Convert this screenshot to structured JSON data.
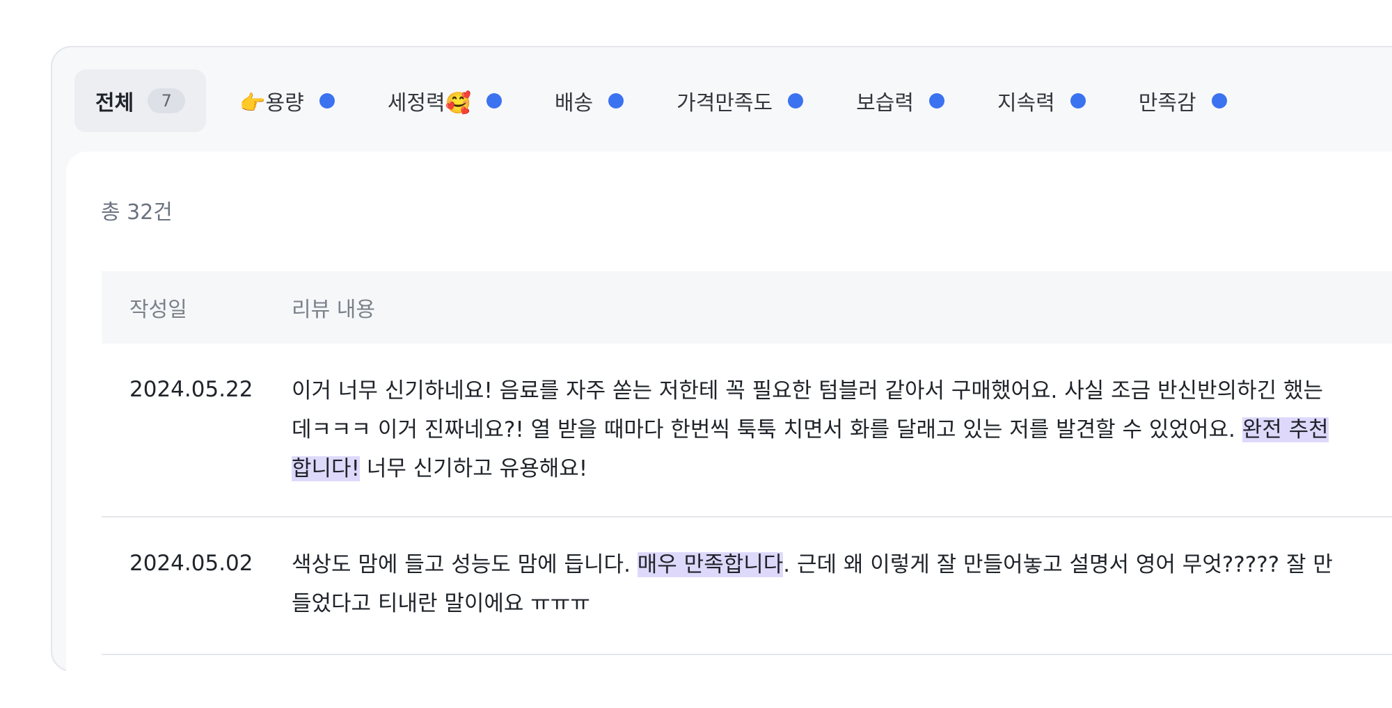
{
  "tabs": [
    {
      "label": "전체",
      "count": "7",
      "active": true
    },
    {
      "label": "👉용량"
    },
    {
      "label": "세정력🥰"
    },
    {
      "label": "배송"
    },
    {
      "label": "가격만족도"
    },
    {
      "label": "보습력"
    },
    {
      "label": "지속력"
    },
    {
      "label": "만족감"
    }
  ],
  "summary": {
    "total": "총 32건"
  },
  "table": {
    "headers": {
      "date": "작성일",
      "content": "리뷰 내용"
    },
    "rows": [
      {
        "date": "2024.05.22",
        "text_before": "이거 너무 신기하네요! 음료를 자주 쏟는 저한테 꼭 필요한 텀블러 같아서 구매했어요. 사실 조금 반신반의하긴 했는데ㅋㅋㅋ 이거 진짜네요?! 열 받을 때마다 한번씩 툭툭 치면서 화를 달래고 있는 저를 발견할 수 있었어요. ",
        "highlight": "완전 추천합니다!",
        "text_after": " 너무 신기하고 유용해요!"
      },
      {
        "date": "2024.05.02",
        "text_before": "색상도 맘에 들고 성능도 맘에 듭니다. ",
        "highlight": "매우 만족합니다",
        "text_after": ". 근데 왜 이렇게 잘 만들어놓고 설명서 영어 무엇????? 잘 만들었다고 티내란 말이에요 ㅠㅠㅠ"
      }
    ]
  },
  "colors": {
    "accent_dot": "#3b72f0",
    "highlight": "#ded9fb"
  }
}
